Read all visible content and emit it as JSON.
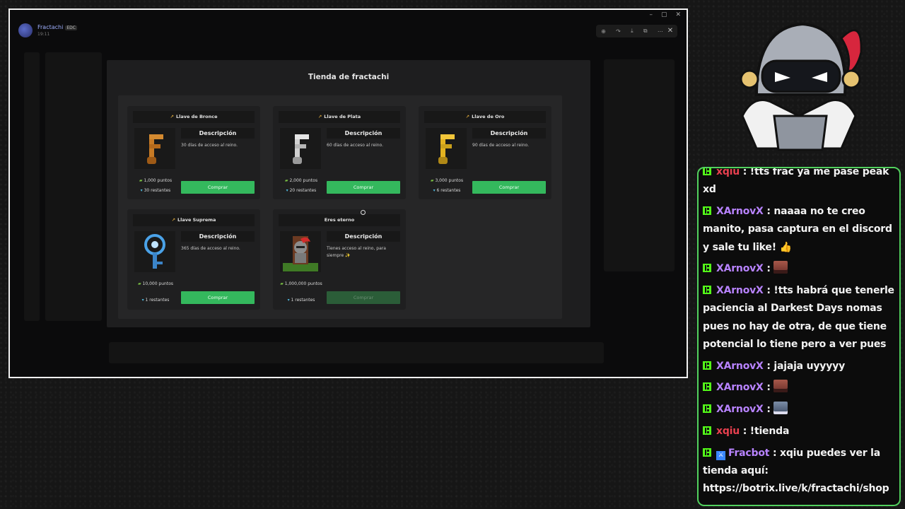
{
  "capture": {
    "user": {
      "name": "Fractachi",
      "badge": "EDC",
      "time": "19:11"
    },
    "viewer_tools": [
      "zoom-icon",
      "share-icon",
      "download-icon",
      "open-external-icon",
      "more-icon"
    ],
    "shop": {
      "title": "Tienda de fractachi",
      "description_label": "Descripción",
      "items": [
        {
          "name": "Llave de Bronce",
          "icon": "key-icon",
          "color": "#c77a25",
          "description": "30 días de acceso al reino.",
          "price": "1,000 puntos",
          "stock": "30 restantes",
          "button": "Comprar",
          "enabled": true
        },
        {
          "name": "Llave de Plata",
          "icon": "key-icon",
          "color": "#c9c9c9",
          "description": "60 días de acceso al reino.",
          "price": "2,000 puntos",
          "stock": "20 restantes",
          "button": "Comprar",
          "enabled": true
        },
        {
          "name": "Llave de Oro",
          "icon": "key-icon",
          "color": "#e3b220",
          "description": "90 días de acceso al reino.",
          "price": "3,000 puntos",
          "stock": "6 restantes",
          "button": "Comprar",
          "enabled": true
        },
        {
          "name": "Llave Suprema",
          "icon": "key-icon",
          "color": "#4aa2e8",
          "description": "365 días de acceso al reino.",
          "price": "10,000 puntos",
          "stock": "1 restantes",
          "button": "Comprar",
          "enabled": true
        },
        {
          "name": "Eres eterno",
          "icon": "",
          "color": "",
          "description": "Tienes acceso al reino, para siempre ✨",
          "price": "1,000,000 puntos",
          "stock": "1 restantes",
          "button": "Comprar",
          "enabled": false
        }
      ]
    }
  },
  "chat": {
    "messages": [
      {
        "user": "xqiu",
        "color": "#e8404f",
        "text": "!tts frac ya me pase peak xd"
      },
      {
        "user": "XArnovX",
        "color": "#b883ff",
        "text": "naaaa no te creo manito, pasa captura en el discord y sale tu like! 👍"
      },
      {
        "user": "XArnovX",
        "color": "#b883ff",
        "text": "",
        "emote": "face-emote"
      },
      {
        "user": "XArnovX",
        "color": "#b883ff",
        "text": "!tts habrá que tenerle paciencia al Darkest Days nomas pues no hay de otra, de que tiene potencial lo tiene pero a ver pues"
      },
      {
        "user": "XArnovX",
        "color": "#b883ff",
        "text": "jajaja uyyyyy"
      },
      {
        "user": "XArnovX",
        "color": "#b883ff",
        "text": "",
        "emote": "face-emote"
      },
      {
        "user": "XArnovX",
        "color": "#b883ff",
        "text": "",
        "emote": "shark-emote"
      },
      {
        "user": "xqiu",
        "color": "#e8404f",
        "text": "!tienda"
      },
      {
        "user": "Fracbot",
        "color": "#b883ff",
        "bot": true,
        "text": "xqiu puedes ver la tienda aquí: https://botrix.live/k/fractachi/shop"
      }
    ]
  }
}
